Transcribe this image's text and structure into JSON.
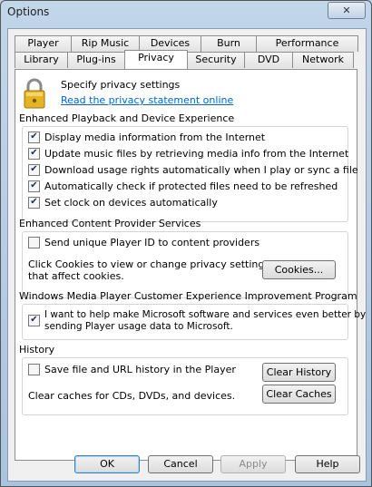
{
  "window": {
    "title": "Options",
    "close_glyph": "✕"
  },
  "tabs": {
    "row1": [
      "Player",
      "Rip Music",
      "Devices",
      "Burn",
      "Performance"
    ],
    "row2": [
      "Library",
      "Plug-ins",
      "Privacy",
      "Security",
      "DVD",
      "Network"
    ],
    "active": "Privacy"
  },
  "header": {
    "icon": "padlock-icon",
    "text": "Specify privacy settings",
    "link": "Read the privacy statement online"
  },
  "enhanced_playback": {
    "title": "Enhanced Playback and Device Experience",
    "options": [
      {
        "label": "Display media information from the Internet",
        "checked": true
      },
      {
        "label": "Update music files by retrieving media info from the Internet",
        "checked": true
      },
      {
        "label": "Download usage rights automatically when I play or sync a file",
        "checked": true
      },
      {
        "label": "Automatically check if protected files need to be refreshed",
        "checked": true
      },
      {
        "label": "Set clock on devices automatically",
        "checked": true
      }
    ]
  },
  "content_provider": {
    "title": "Enhanced Content Provider Services",
    "option": {
      "label": "Send unique Player ID to content providers",
      "checked": false
    },
    "cookies_text_1": "Click Cookies to view or change privacy settings",
    "cookies_text_2": "that affect cookies.",
    "cookies_button": "Cookies..."
  },
  "ceip": {
    "title": "Windows Media Player Customer Experience Improvement Program",
    "option_line1": "I want to help make Microsoft software and services even better by",
    "option_line2": "sending Player usage data to Microsoft.",
    "checked": true
  },
  "history": {
    "title": "History",
    "option": {
      "label": "Save file and URL history in the Player",
      "checked": false
    },
    "clear_history_button": "Clear History",
    "caches_text": "Clear caches for CDs, DVDs, and devices.",
    "clear_caches_button": "Clear Caches"
  },
  "buttons": {
    "ok": "OK",
    "cancel": "Cancel",
    "apply": "Apply",
    "help": "Help"
  }
}
